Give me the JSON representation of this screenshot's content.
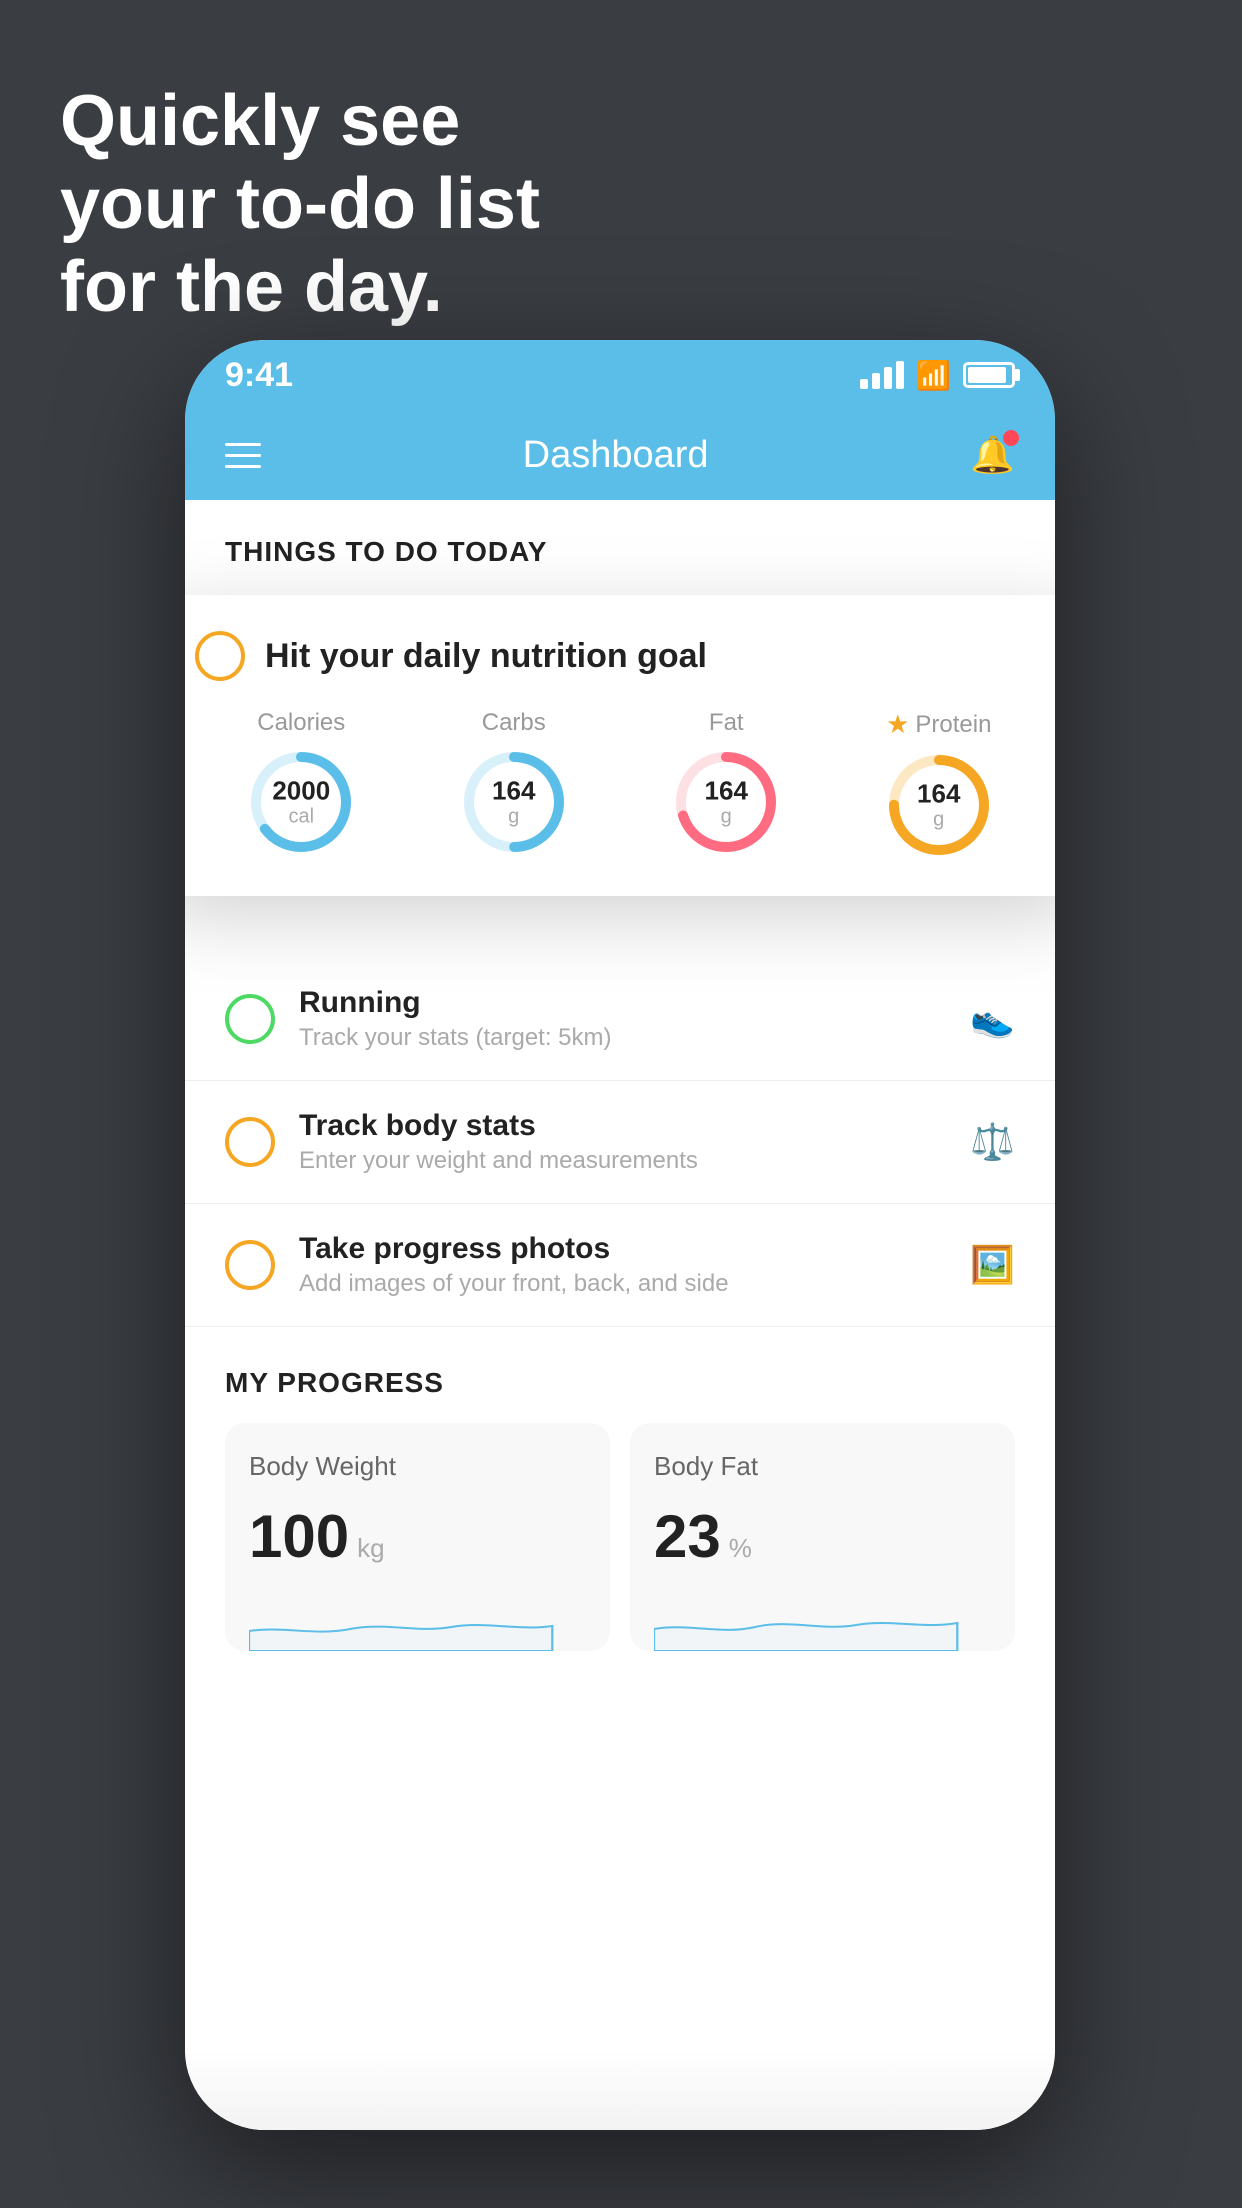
{
  "background": "#3a3d42",
  "hero": {
    "line1": "Quickly see",
    "line2": "your to-do list",
    "line3": "for the day."
  },
  "status_bar": {
    "time": "9:41",
    "signal": "signal-icon",
    "wifi": "wifi-icon",
    "battery": "battery-icon"
  },
  "header": {
    "title": "Dashboard",
    "menu_icon": "hamburger-icon",
    "bell_icon": "bell-icon"
  },
  "things_to_do": {
    "section_label": "THINGS TO DO TODAY"
  },
  "nutrition_card": {
    "title": "Hit your daily nutrition goal",
    "items": [
      {
        "label": "Calories",
        "value": "2000",
        "unit": "cal",
        "color": "#5bbee8",
        "track_color": "#d8f0fa",
        "progress": 0.65
      },
      {
        "label": "Carbs",
        "value": "164",
        "unit": "g",
        "color": "#5bbee8",
        "track_color": "#d8f0fa",
        "progress": 0.5
      },
      {
        "label": "Fat",
        "value": "164",
        "unit": "g",
        "color": "#ff6b81",
        "track_color": "#fde0e4",
        "progress": 0.7
      },
      {
        "label": "Protein",
        "value": "164",
        "unit": "g",
        "color": "#f5a623",
        "track_color": "#fde8c4",
        "progress": 0.75,
        "starred": true
      }
    ]
  },
  "todo_items": [
    {
      "title": "Running",
      "subtitle": "Track your stats (target: 5km)",
      "circle": "green",
      "icon": "shoe-icon"
    },
    {
      "title": "Track body stats",
      "subtitle": "Enter your weight and measurements",
      "circle": "yellow",
      "icon": "scale-icon"
    },
    {
      "title": "Take progress photos",
      "subtitle": "Add images of your front, back, and side",
      "circle": "yellow",
      "icon": "person-icon"
    }
  ],
  "progress": {
    "section_label": "MY PROGRESS",
    "cards": [
      {
        "title": "Body Weight",
        "value": "100",
        "unit": "kg"
      },
      {
        "title": "Body Fat",
        "value": "23",
        "unit": "%"
      }
    ]
  }
}
